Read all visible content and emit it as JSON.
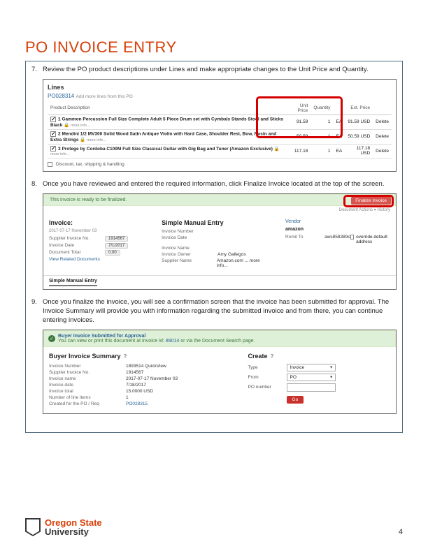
{
  "title": "PO INVOICE ENTRY",
  "steps": {
    "s7": {
      "num": "7.",
      "text": "Review the PO product descriptions under Lines and make appropriate changes to the Unit Price and Quantity."
    },
    "s8": {
      "num": "8.",
      "text": "Once you have reviewed and entered the required information, click Finalize Invoice located at the top of the screen."
    },
    "s9": {
      "num": "9.",
      "text": "Once you finalize the invoice, you will see a confirmation screen that the invoice has been submitted for approval. The Invoice Summary will provide you with information regarding the submitted invoice and from there, you can continue entering invoices."
    }
  },
  "shot7": {
    "lines": "Lines",
    "po": "PO028314",
    "po_hint": "Add more lines from this PO",
    "headers": {
      "desc": "Product Description",
      "unit": "Unit Price",
      "qty": "Quantity",
      "ext": "Ext. Price"
    },
    "rows": [
      {
        "n": "1",
        "desc": "Gammon Percussion Full Size Complete Adult 5 Piece Drum set with Cymbals Stands Stool and Sticks Black",
        "more": "more info...",
        "unit": "91.59",
        "qty": "1",
        "uom": "EA",
        "ext": "91.59 USD",
        "del": "Delete"
      },
      {
        "n": "2",
        "desc": "Mendini 1/2 MV300 Solid Wood Satin Antique Violin with Hard Case, Shoulder Rest, Bow, Rosin and Extra Strings",
        "more": "more info...",
        "unit": "50.59",
        "qty": "1",
        "uom": "EA",
        "ext": "50.59 USD",
        "del": "Delete"
      },
      {
        "n": "3",
        "desc": "Protege by Cordoba C100M Full Size Classical Guitar with Gig Bag and Tuner (Amazon Exclusive)",
        "more": "more info...",
        "unit": "117.18",
        "qty": "1",
        "uom": "EA",
        "ext": "117.18 USD",
        "del": "Delete"
      }
    ],
    "discount": "Discount, tax, shipping & handling"
  },
  "shot8": {
    "ready": "This invoice is ready to be finalized.",
    "finalize": "Finalize Invoice",
    "doc_actions": "Document Actions ▾   History",
    "invoice_hdr": "Invoice:",
    "sme": "Simple Manual Entry",
    "date": "2017-07-17 November 03",
    "left": [
      {
        "k": "Supplier Invoice No.",
        "v": "1914567"
      },
      {
        "k": "Invoice Date",
        "v": "7/1/2017"
      },
      {
        "k": "Document Total",
        "v": "0.00"
      },
      {
        "k": "View Related Documents",
        "v": ""
      }
    ],
    "mid_label_num": "Invoice Number",
    "mid_label_date": "Invoice Date",
    "mid_label_name": "Invoice Name",
    "mid_label_owner": "Invoice Owner",
    "mid_label_supplier": "Supplier Name",
    "mid_owner": "Amy Gallegos",
    "mid_supplier": "Amazon.com ... more info...",
    "right_vendor": "Vendor",
    "right_vendor_val": "amazon",
    "right_remit": "Remit To",
    "right_remit_val": "aws858389c",
    "right_chk": "override default address",
    "tab": "Simple Manual Entry"
  },
  "shot9": {
    "bar_text": "Buyer Invoice Submitted for Approval",
    "bar_sub": "You can view or print this document at Invoice Id:",
    "bar_link": "89014",
    "bar_sub2": "or via the Document Search page.",
    "summary_title": "Buyer Invoice Summary",
    "rows": [
      {
        "k": "Invoice Number",
        "v": "1893514 QuickView"
      },
      {
        "k": "Supplier Invoice No.",
        "v": "1914567"
      },
      {
        "k": "Invoice name",
        "v": "2017-07-17 November 03"
      },
      {
        "k": "Invoice date",
        "v": "7/18/2017"
      },
      {
        "k": "Invoice total",
        "v": "15.0000 USD"
      },
      {
        "k": "Number of line items",
        "v": "1"
      },
      {
        "k": "Created for the PO / Req",
        "v": "PO028315"
      }
    ],
    "create_title": "Create",
    "type_lbl": "Type",
    "type_val": "Invoice",
    "from_lbl": "From",
    "from_val": "PO",
    "ponum_lbl": "PO number",
    "go": "Go"
  },
  "footer": {
    "logo1": "Oregon State",
    "logo2": "University",
    "page": "4"
  }
}
